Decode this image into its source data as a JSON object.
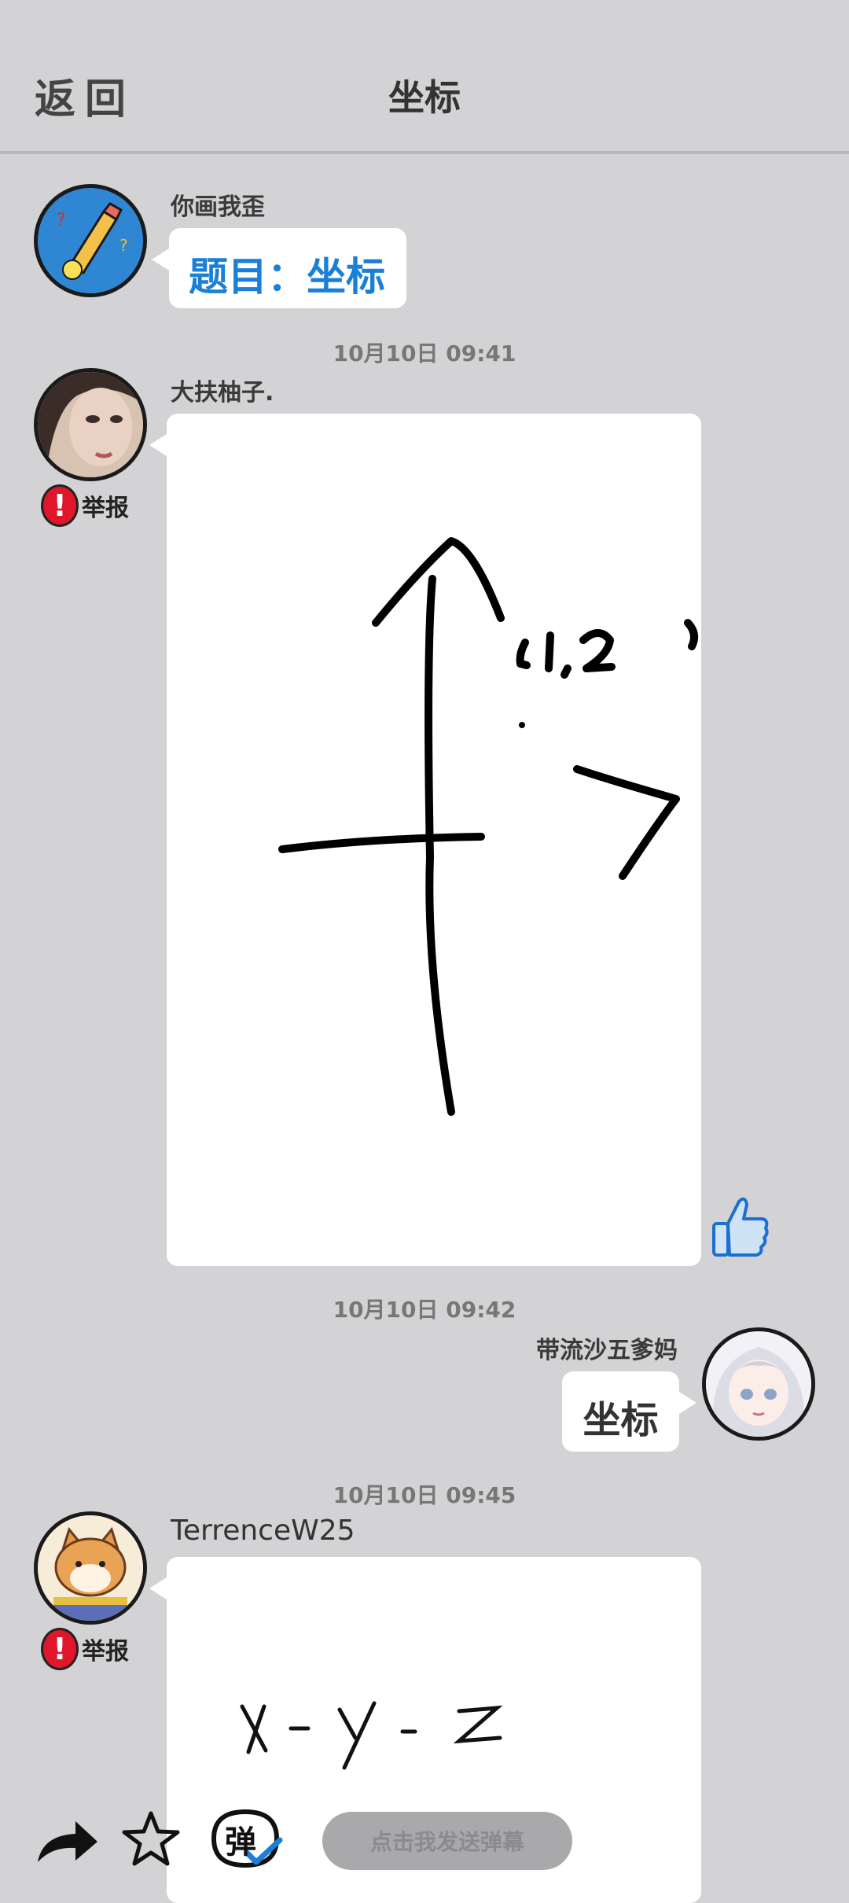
{
  "header": {
    "back_label": "返回",
    "title": "坐标"
  },
  "messages": [
    {
      "name": "你画我歪",
      "text": "题目：坐标"
    },
    {
      "time": "10月10日  09:41",
      "name": "大扶柚子.",
      "report_label": "举报",
      "drawing_text": "(1,2)"
    },
    {
      "time": "10月10日  09:42",
      "name": "带流沙五爹妈",
      "text": "坐标"
    },
    {
      "time": "10月10日  09:45",
      "name": "TerrenceW25",
      "report_label": "举报",
      "drawing_text": "x - y - z"
    }
  ],
  "toolbar": {
    "danmaku_icon_char": "弹",
    "danmaku_placeholder": "点击我发送弹幕",
    "icons": [
      "share-arrow-icon",
      "star-icon",
      "danmaku-toggle-icon"
    ]
  },
  "colors": {
    "background": "#d3d3d5",
    "accent_blue": "#1a7fd6",
    "report_red": "#e0162b"
  }
}
